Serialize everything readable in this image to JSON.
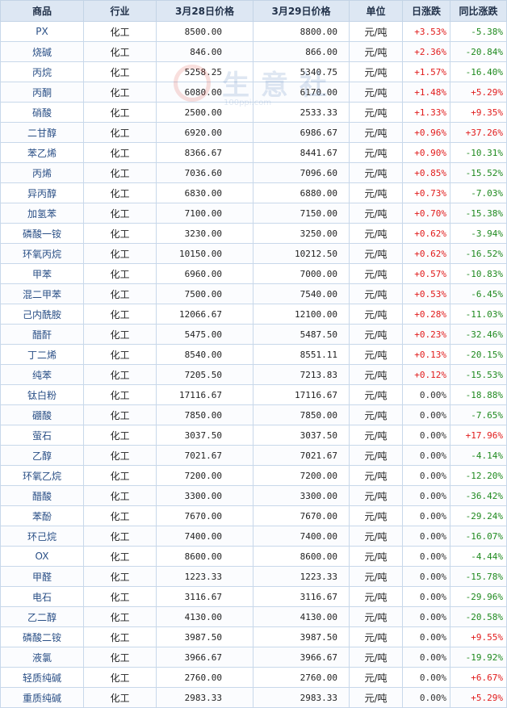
{
  "headers": [
    "商品",
    "行业",
    "3月28日价格",
    "3月29日价格",
    "单位",
    "日涨跌",
    "同比涨跌"
  ],
  "watermark": {
    "text": "生意社",
    "url": "100ppi.com"
  },
  "rows": [
    {
      "name": "PX",
      "industry": "化工",
      "p1": "8500.00",
      "p2": "8800.00",
      "unit": "元/吨",
      "day": "+3.53%",
      "yoy": "-5.38%"
    },
    {
      "name": "烧碱",
      "industry": "化工",
      "p1": "846.00",
      "p2": "866.00",
      "unit": "元/吨",
      "day": "+2.36%",
      "yoy": "-20.84%"
    },
    {
      "name": "丙烷",
      "industry": "化工",
      "p1": "5258.25",
      "p2": "5340.75",
      "unit": "元/吨",
      "day": "+1.57%",
      "yoy": "-16.40%"
    },
    {
      "name": "丙酮",
      "industry": "化工",
      "p1": "6080.00",
      "p2": "6170.00",
      "unit": "元/吨",
      "day": "+1.48%",
      "yoy": "+5.29%"
    },
    {
      "name": "硝酸",
      "industry": "化工",
      "p1": "2500.00",
      "p2": "2533.33",
      "unit": "元/吨",
      "day": "+1.33%",
      "yoy": "+9.35%"
    },
    {
      "name": "二甘醇",
      "industry": "化工",
      "p1": "6920.00",
      "p2": "6986.67",
      "unit": "元/吨",
      "day": "+0.96%",
      "yoy": "+37.26%"
    },
    {
      "name": "苯乙烯",
      "industry": "化工",
      "p1": "8366.67",
      "p2": "8441.67",
      "unit": "元/吨",
      "day": "+0.90%",
      "yoy": "-10.31%"
    },
    {
      "name": "丙烯",
      "industry": "化工",
      "p1": "7036.60",
      "p2": "7096.60",
      "unit": "元/吨",
      "day": "+0.85%",
      "yoy": "-15.52%"
    },
    {
      "name": "异丙醇",
      "industry": "化工",
      "p1": "6830.00",
      "p2": "6880.00",
      "unit": "元/吨",
      "day": "+0.73%",
      "yoy": "-7.03%"
    },
    {
      "name": "加氢苯",
      "industry": "化工",
      "p1": "7100.00",
      "p2": "7150.00",
      "unit": "元/吨",
      "day": "+0.70%",
      "yoy": "-15.38%"
    },
    {
      "name": "磷酸一铵",
      "industry": "化工",
      "p1": "3230.00",
      "p2": "3250.00",
      "unit": "元/吨",
      "day": "+0.62%",
      "yoy": "-3.94%"
    },
    {
      "name": "环氧丙烷",
      "industry": "化工",
      "p1": "10150.00",
      "p2": "10212.50",
      "unit": "元/吨",
      "day": "+0.62%",
      "yoy": "-16.52%"
    },
    {
      "name": "甲苯",
      "industry": "化工",
      "p1": "6960.00",
      "p2": "7000.00",
      "unit": "元/吨",
      "day": "+0.57%",
      "yoy": "-10.83%"
    },
    {
      "name": "混二甲苯",
      "industry": "化工",
      "p1": "7500.00",
      "p2": "7540.00",
      "unit": "元/吨",
      "day": "+0.53%",
      "yoy": "-6.45%"
    },
    {
      "name": "己内酰胺",
      "industry": "化工",
      "p1": "12066.67",
      "p2": "12100.00",
      "unit": "元/吨",
      "day": "+0.28%",
      "yoy": "-11.03%"
    },
    {
      "name": "醋酐",
      "industry": "化工",
      "p1": "5475.00",
      "p2": "5487.50",
      "unit": "元/吨",
      "day": "+0.23%",
      "yoy": "-32.46%"
    },
    {
      "name": "丁二烯",
      "industry": "化工",
      "p1": "8540.00",
      "p2": "8551.11",
      "unit": "元/吨",
      "day": "+0.13%",
      "yoy": "-20.15%"
    },
    {
      "name": "纯苯",
      "industry": "化工",
      "p1": "7205.50",
      "p2": "7213.83",
      "unit": "元/吨",
      "day": "+0.12%",
      "yoy": "-15.53%"
    },
    {
      "name": "钛白粉",
      "industry": "化工",
      "p1": "17116.67",
      "p2": "17116.67",
      "unit": "元/吨",
      "day": "0.00%",
      "yoy": "-18.88%"
    },
    {
      "name": "硼酸",
      "industry": "化工",
      "p1": "7850.00",
      "p2": "7850.00",
      "unit": "元/吨",
      "day": "0.00%",
      "yoy": "-7.65%"
    },
    {
      "name": "萤石",
      "industry": "化工",
      "p1": "3037.50",
      "p2": "3037.50",
      "unit": "元/吨",
      "day": "0.00%",
      "yoy": "+17.96%"
    },
    {
      "name": "乙醇",
      "industry": "化工",
      "p1": "7021.67",
      "p2": "7021.67",
      "unit": "元/吨",
      "day": "0.00%",
      "yoy": "-4.14%"
    },
    {
      "name": "环氧乙烷",
      "industry": "化工",
      "p1": "7200.00",
      "p2": "7200.00",
      "unit": "元/吨",
      "day": "0.00%",
      "yoy": "-12.20%"
    },
    {
      "name": "醋酸",
      "industry": "化工",
      "p1": "3300.00",
      "p2": "3300.00",
      "unit": "元/吨",
      "day": "0.00%",
      "yoy": "-36.42%"
    },
    {
      "name": "苯酚",
      "industry": "化工",
      "p1": "7670.00",
      "p2": "7670.00",
      "unit": "元/吨",
      "day": "0.00%",
      "yoy": "-29.24%"
    },
    {
      "name": "环己烷",
      "industry": "化工",
      "p1": "7400.00",
      "p2": "7400.00",
      "unit": "元/吨",
      "day": "0.00%",
      "yoy": "-16.07%"
    },
    {
      "name": "OX",
      "industry": "化工",
      "p1": "8600.00",
      "p2": "8600.00",
      "unit": "元/吨",
      "day": "0.00%",
      "yoy": "-4.44%"
    },
    {
      "name": "甲醛",
      "industry": "化工",
      "p1": "1223.33",
      "p2": "1223.33",
      "unit": "元/吨",
      "day": "0.00%",
      "yoy": "-15.78%"
    },
    {
      "name": "电石",
      "industry": "化工",
      "p1": "3116.67",
      "p2": "3116.67",
      "unit": "元/吨",
      "day": "0.00%",
      "yoy": "-29.96%"
    },
    {
      "name": "乙二醇",
      "industry": "化工",
      "p1": "4130.00",
      "p2": "4130.00",
      "unit": "元/吨",
      "day": "0.00%",
      "yoy": "-20.58%"
    },
    {
      "name": "磷酸二铵",
      "industry": "化工",
      "p1": "3987.50",
      "p2": "3987.50",
      "unit": "元/吨",
      "day": "0.00%",
      "yoy": "+9.55%"
    },
    {
      "name": "液氯",
      "industry": "化工",
      "p1": "3966.67",
      "p2": "3966.67",
      "unit": "元/吨",
      "day": "0.00%",
      "yoy": "-19.92%"
    },
    {
      "name": "轻质纯碱",
      "industry": "化工",
      "p1": "2760.00",
      "p2": "2760.00",
      "unit": "元/吨",
      "day": "0.00%",
      "yoy": "+6.67%"
    },
    {
      "name": "重质纯碱",
      "industry": "化工",
      "p1": "2983.33",
      "p2": "2983.33",
      "unit": "元/吨",
      "day": "0.00%",
      "yoy": "+5.29%"
    }
  ]
}
